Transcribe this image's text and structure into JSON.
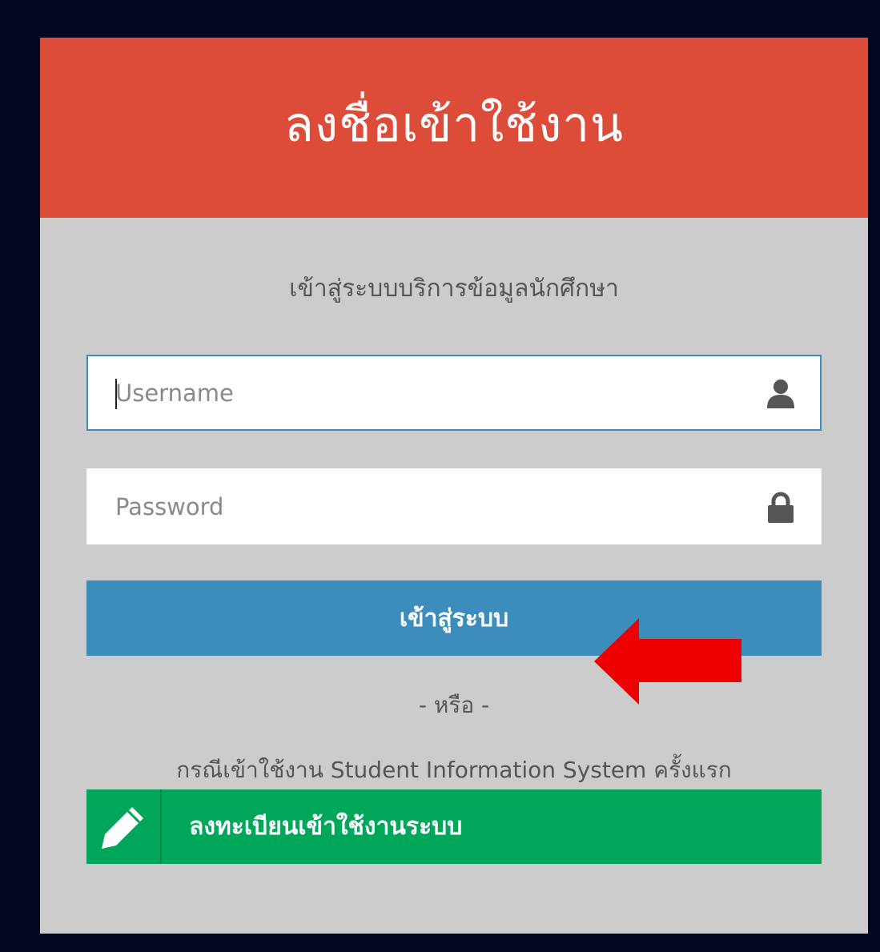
{
  "header": {
    "title": "ลงชื่อเข้าใช้งาน"
  },
  "login": {
    "subtitle": "เข้าสู่ระบบบริการข้อมูลนักศึกษา",
    "username_placeholder": "Username",
    "username_icon": "user-icon",
    "password_placeholder": "Password",
    "password_icon": "lock-icon",
    "submit_label": "เข้าสู่ระบบ",
    "or_text": "- หรือ -",
    "first_time_text": "กรณีเข้าใช้งาน Student Information System ครั้งแรก",
    "register_label": "ลงทะเบียนเข้าใช้งานระบบ",
    "register_icon": "pencil-icon"
  },
  "colors": {
    "header_bg": "#dd4b39",
    "card_bg": "#cccccc",
    "primary_button": "#3c8dbc",
    "register_button": "#00a65a",
    "annotation_arrow": "#ee0000",
    "page_bg": "#02061f"
  }
}
